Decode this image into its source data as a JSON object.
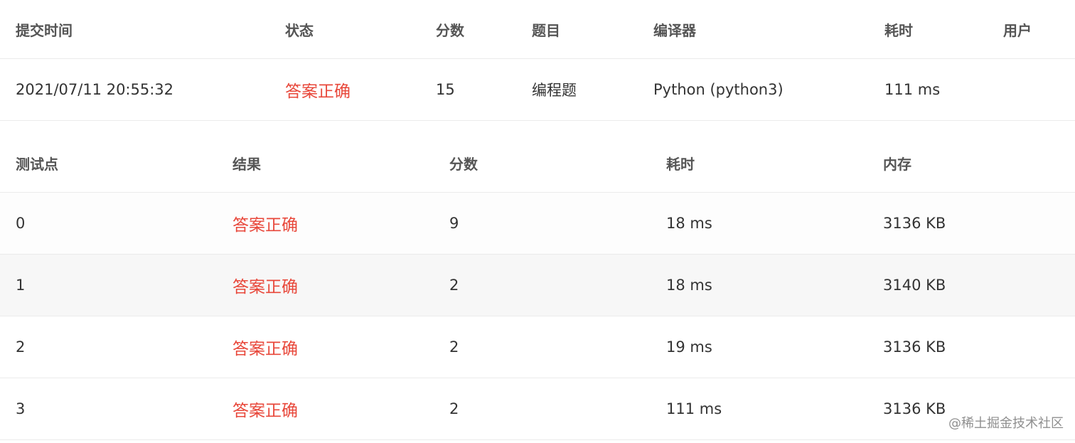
{
  "summary": {
    "headers": {
      "time": "提交时间",
      "status": "状态",
      "score": "分数",
      "problem": "题目",
      "compiler": "编译器",
      "cost": "耗时",
      "user": "用户"
    },
    "row": {
      "time": "2021/07/11 20:55:32",
      "status": "答案正确",
      "score": "15",
      "problem": "编程题",
      "compiler": "Python (python3)",
      "cost": "111 ms",
      "user": ""
    }
  },
  "testcases": {
    "headers": {
      "case": "测试点",
      "result": "结果",
      "score": "分数",
      "cost": "耗时",
      "memory": "内存"
    },
    "rows": [
      {
        "case": "0",
        "result": "答案正确",
        "score": "9",
        "cost": "18 ms",
        "memory": "3136 KB"
      },
      {
        "case": "1",
        "result": "答案正确",
        "score": "2",
        "cost": "18 ms",
        "memory": "3140 KB"
      },
      {
        "case": "2",
        "result": "答案正确",
        "score": "2",
        "cost": "19 ms",
        "memory": "3136 KB"
      },
      {
        "case": "3",
        "result": "答案正确",
        "score": "2",
        "cost": "111 ms",
        "memory": "3136 KB"
      }
    ]
  },
  "watermark": "@稀土掘金技术社区",
  "colors": {
    "accepted": "#e8473a",
    "header_text": "#555555",
    "border": "#ebebeb",
    "row_alt": "#f7f7f7"
  }
}
